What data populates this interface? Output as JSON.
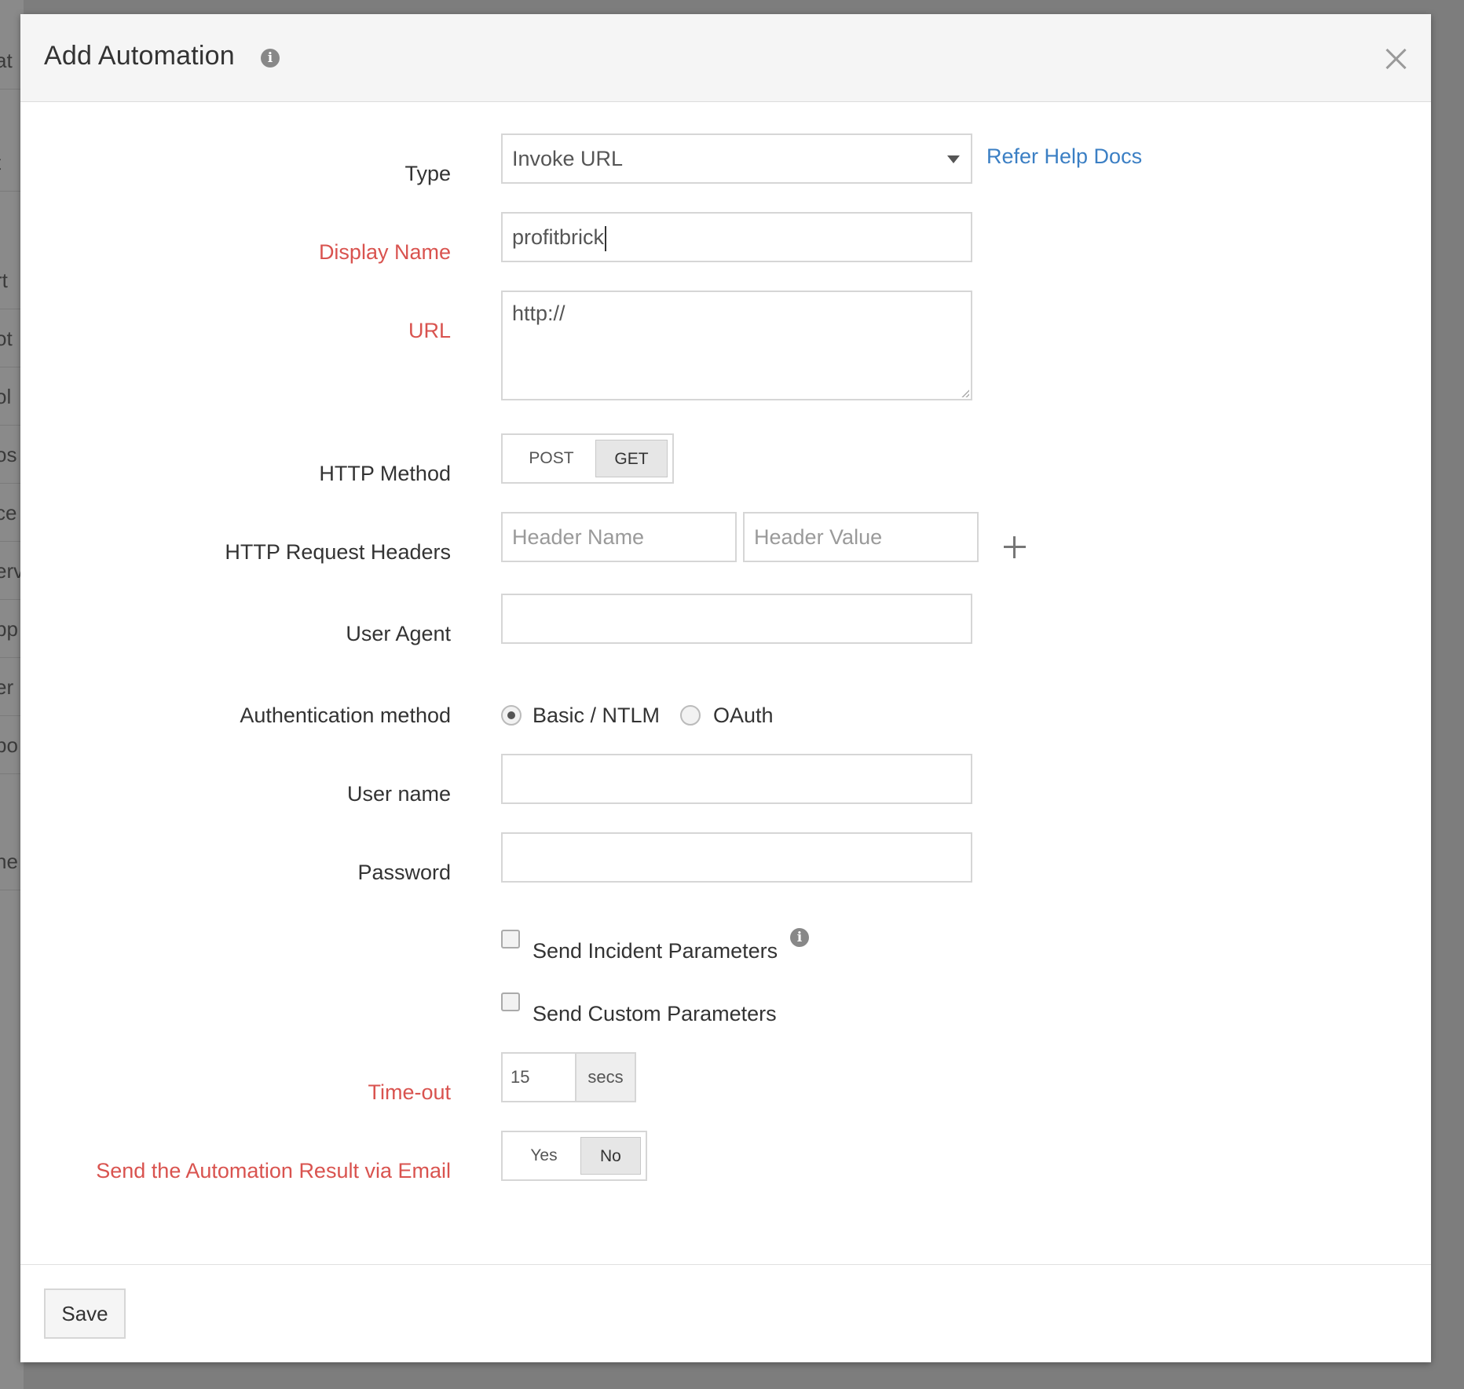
{
  "background": {
    "fragments": [
      "at",
      "t",
      "rt",
      "ot",
      "ol",
      "os",
      "ce",
      "erv",
      "pp",
      "er",
      "po",
      "ne"
    ]
  },
  "modal": {
    "title": "Add Automation",
    "close_label": "×"
  },
  "form": {
    "type": {
      "label": "Type",
      "value": "Invoke URL",
      "help_link": "Refer Help Docs"
    },
    "display_name": {
      "label": "Display Name",
      "value": "profitbrick"
    },
    "url": {
      "label": "URL",
      "value": "http://"
    },
    "http_method": {
      "label": "HTTP Method",
      "options": [
        "POST",
        "GET"
      ],
      "selected": "GET"
    },
    "http_headers": {
      "label": "HTTP Request Headers",
      "name_placeholder": "Header Name",
      "value_placeholder": "Header Value"
    },
    "user_agent": {
      "label": "User Agent",
      "value": ""
    },
    "auth_method": {
      "label": "Authentication method",
      "options": [
        "Basic / NTLM",
        "OAuth"
      ],
      "selected": "Basic / NTLM"
    },
    "user_name": {
      "label": "User name",
      "value": ""
    },
    "password": {
      "label": "Password",
      "value": ""
    },
    "send_incident_params": {
      "label": "Send Incident Parameters",
      "checked": false
    },
    "send_custom_params": {
      "label": "Send Custom Parameters",
      "checked": false
    },
    "timeout": {
      "label": "Time-out",
      "value": "15",
      "unit": "secs"
    },
    "email_result": {
      "label": "Send the Automation Result via Email",
      "options": [
        "Yes",
        "No"
      ],
      "selected": "No"
    }
  },
  "footer": {
    "save_label": "Save"
  },
  "colors": {
    "required_label": "#d9534f",
    "link": "#3b7fc4"
  }
}
